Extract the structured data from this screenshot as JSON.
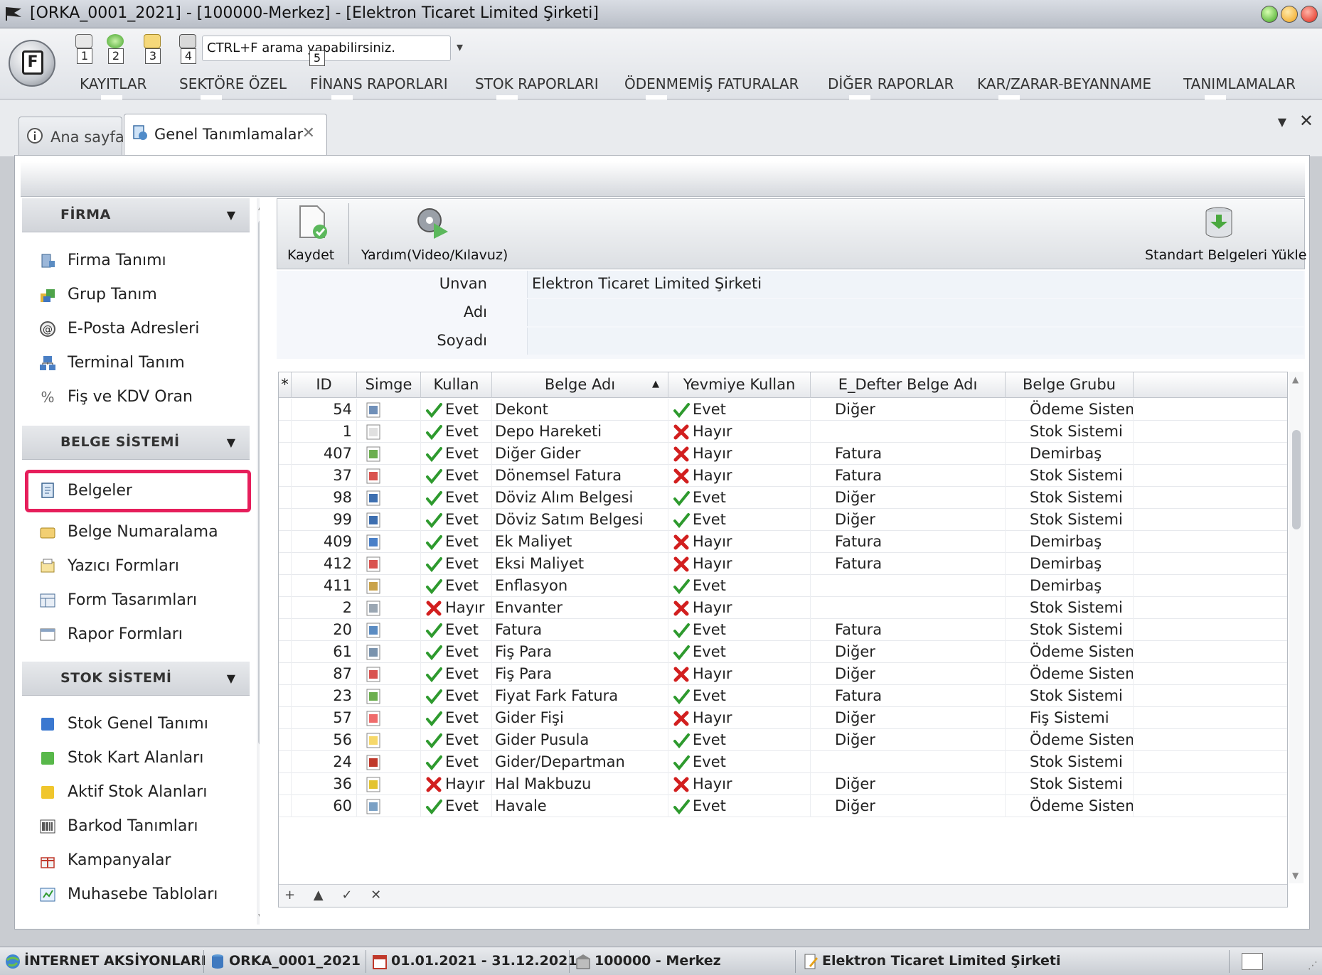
{
  "window": {
    "title": "[ORKA_0001_2021]  -  [100000-Merkez]  -  [Elektron Ticaret Limited Şirketi]"
  },
  "ribbon": {
    "orb_letter": "F",
    "quick_access": [
      "1",
      "2",
      "3",
      "4"
    ],
    "search_placeholder": "CTRL+F arama yapabilirsiniz.",
    "search_keytip": "5",
    "menu": [
      "KAYITLAR",
      "SEKTÖRE ÖZEL",
      "FİNANS RAPORLARI",
      "STOK RAPORLARI",
      "ÖDENMEMİŞ FATURALAR",
      "DİĞER RAPORLAR",
      "KAR/ZARAR-BEYANNAME",
      "TANIMLAMALAR"
    ]
  },
  "tabs": {
    "home": "Ana sayfa",
    "general": "Genel Tanımlamalar",
    "close_glyph": "✕"
  },
  "sidebar": {
    "groups": [
      {
        "label": "FİRMA",
        "items": [
          "Firma Tanımı",
          "Grup Tanım",
          "E-Posta Adresleri",
          "Terminal Tanım",
          "Fiş ve KDV Oran"
        ]
      },
      {
        "label": "BELGE SİSTEMİ",
        "items": [
          "Belgeler",
          "Belge Numaralama",
          "Yazıcı Formları",
          "Form Tasarımları",
          "Rapor Formları"
        ]
      },
      {
        "label": "STOK SİSTEMİ",
        "items": [
          "Stok Genel Tanımı",
          "Stok Kart Alanları",
          "Aktif Stok Alanları",
          "Barkod Tanımları",
          "Kampanyalar",
          "Muhasebe Tabloları"
        ]
      }
    ],
    "selected": "Belgeler"
  },
  "toolbar": {
    "save": "Kaydet",
    "help": "Yardım(Video/Kılavuz)",
    "load_std": "Standart Belgeleri Yükle"
  },
  "form": {
    "unvan_label": "Unvan",
    "unvan_value": "Elektron Ticaret Limited Şirketi",
    "adi_label": "Adı",
    "adi_value": "",
    "soyadi_label": "Soyadı",
    "soyadi_value": ""
  },
  "grid": {
    "columns": [
      "*",
      "ID",
      "Simge",
      "Kullan",
      "Belge Adı",
      "Yevmiye Kullan",
      "E_Defter Belge Adı",
      "Belge Grubu"
    ],
    "sort_indicator": "▲",
    "rows": [
      [
        "54",
        "Evet",
        "Dekont",
        "Evet",
        "Diğer",
        "Ödeme Sistemi"
      ],
      [
        "1",
        "Evet",
        "Depo Hareketi",
        "Hayır",
        "",
        "Stok Sistemi"
      ],
      [
        "407",
        "Evet",
        "Diğer Gider",
        "Hayır",
        "Fatura",
        "Demirbaş"
      ],
      [
        "37",
        "Evet",
        "Dönemsel Fatura",
        "Hayır",
        "Fatura",
        "Stok Sistemi"
      ],
      [
        "98",
        "Evet",
        "Döviz Alım Belgesi",
        "Evet",
        "Diğer",
        "Stok Sistemi"
      ],
      [
        "99",
        "Evet",
        "Döviz Satım Belgesi",
        "Evet",
        "Diğer",
        "Stok Sistemi"
      ],
      [
        "409",
        "Evet",
        "Ek Maliyet",
        "Hayır",
        "Fatura",
        "Demirbaş"
      ],
      [
        "412",
        "Evet",
        "Eksi Maliyet",
        "Hayır",
        "Fatura",
        "Demirbaş"
      ],
      [
        "411",
        "Evet",
        "Enflasyon",
        "Evet",
        "",
        "Demirbaş"
      ],
      [
        "2",
        "Hayır",
        "Envanter",
        "Hayır",
        "",
        "Stok Sistemi"
      ],
      [
        "20",
        "Evet",
        "Fatura",
        "Evet",
        "Fatura",
        "Stok Sistemi"
      ],
      [
        "61",
        "Evet",
        "Fiş Para",
        "Evet",
        "Diğer",
        "Ödeme Sistemi"
      ],
      [
        "87",
        "Evet",
        "Fiş Para",
        "Hayır",
        "Diğer",
        "Ödeme Sistemi"
      ],
      [
        "23",
        "Evet",
        "Fiyat Fark Fatura",
        "Evet",
        "Fatura",
        "Stok Sistemi"
      ],
      [
        "57",
        "Evet",
        "Gider Fişi",
        "Hayır",
        "Diğer",
        "Fiş Sistemi"
      ],
      [
        "56",
        "Evet",
        "Gider Pusula",
        "Evet",
        "Diğer",
        "Ödeme Sistemi"
      ],
      [
        "24",
        "Evet",
        "Gider/Departman",
        "Evet",
        "",
        "Stok Sistemi"
      ],
      [
        "36",
        "Hayır",
        "Hal Makbuzu",
        "Hayır",
        "Diğer",
        "Stok Sistemi"
      ],
      [
        "60",
        "Evet",
        "Havale",
        "Evet",
        "Diğer",
        "Ödeme Sistemi"
      ]
    ],
    "footer_nav": "+ ▲ ✓ ✕"
  },
  "statusbar": {
    "items": [
      "İNTERNET AKSİYONLARI",
      "ORKA_0001_2021",
      "01.01.2021 - 31.12.2021",
      "100000 - Merkez",
      "Elektron Ticaret Limited Şirketi"
    ]
  },
  "colors": {
    "yes": "#2e9a2e",
    "no": "#d21f1f",
    "highlight": "#e61e5b"
  }
}
